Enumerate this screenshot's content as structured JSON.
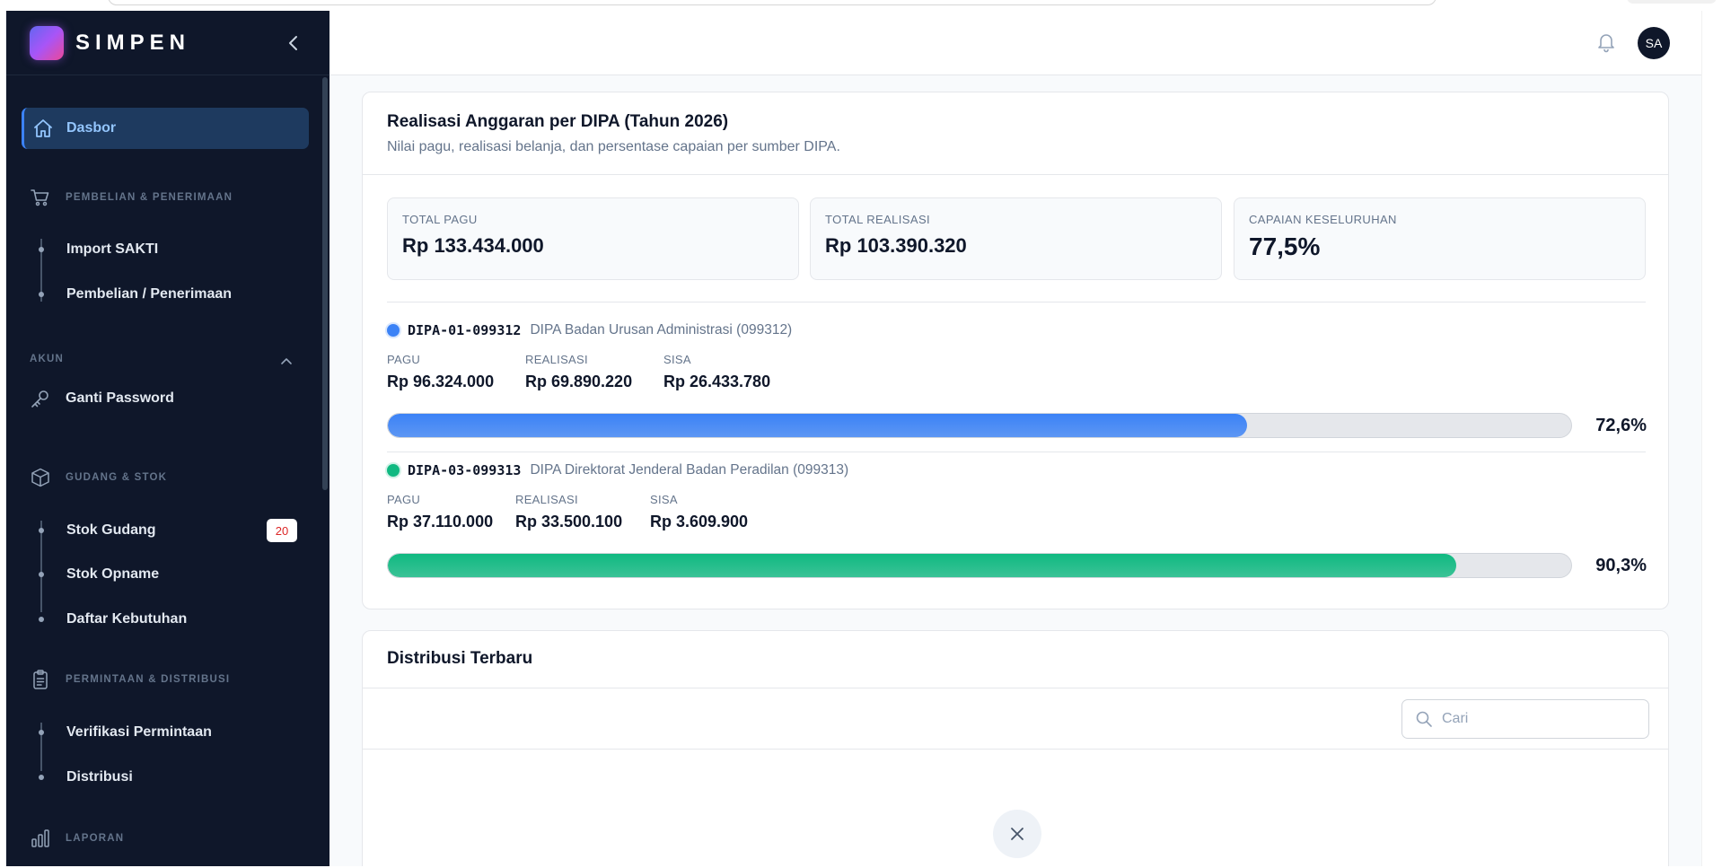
{
  "brand": {
    "name": "SIMPEN"
  },
  "sidebar": {
    "active": {
      "label": "Dasbor",
      "icon": "home-icon"
    },
    "sections": {
      "pembelian": {
        "label": "PEMBELIAN & PENERIMAAN",
        "items": [
          "Import SAKTI",
          "Pembelian / Penerimaan"
        ]
      },
      "akun": {
        "label": "AKUN",
        "item": "Ganti Password"
      },
      "gudang": {
        "label": "GUDANG & STOK",
        "items": [
          "Stok Gudang",
          "Stok Opname",
          "Daftar Kebutuhan"
        ],
        "badge": "20"
      },
      "permintaan": {
        "label": "PERMINTAAN & DISTRIBUSI",
        "items": [
          "Verifikasi Permintaan",
          "Distribusi"
        ]
      },
      "laporan": {
        "label": "LAPORAN"
      }
    }
  },
  "header": {
    "avatar": "SA"
  },
  "realisasi": {
    "title": "Realisasi Anggaran per DIPA (Tahun 2026)",
    "subtitle": "Nilai pagu, realisasi belanja, dan persentase capaian per sumber DIPA.",
    "stats": [
      {
        "label": "TOTAL PAGU",
        "value": "Rp 133.434.000"
      },
      {
        "label": "TOTAL REALISASI",
        "value": "Rp 103.390.320"
      },
      {
        "label": "CAPAIAN KESELURUHAN",
        "value": "77,5%"
      }
    ],
    "labels": {
      "pagu": "PAGU",
      "realisasi": "REALISASI",
      "sisa": "SISA"
    },
    "dipa": [
      {
        "code": "DIPA-01-099312",
        "name": "DIPA Badan Urusan Administrasi (099312)",
        "pagu": "Rp 96.324.000",
        "realisasi": "Rp 69.890.220",
        "sisa": "Rp 26.433.780",
        "percent_text": "72,6%",
        "percent": 72.6,
        "color": "#3b82f6"
      },
      {
        "code": "DIPA-03-099313",
        "name": "DIPA Direktorat Jenderal Badan Peradilan (099313)",
        "pagu": "Rp 37.110.000",
        "realisasi": "Rp 33.500.100",
        "sisa": "Rp 3.609.900",
        "percent_text": "90,3%",
        "percent": 90.3,
        "color": "#10b981"
      }
    ]
  },
  "distribusi": {
    "title": "Distribusi Terbaru",
    "search_placeholder": "Cari"
  }
}
